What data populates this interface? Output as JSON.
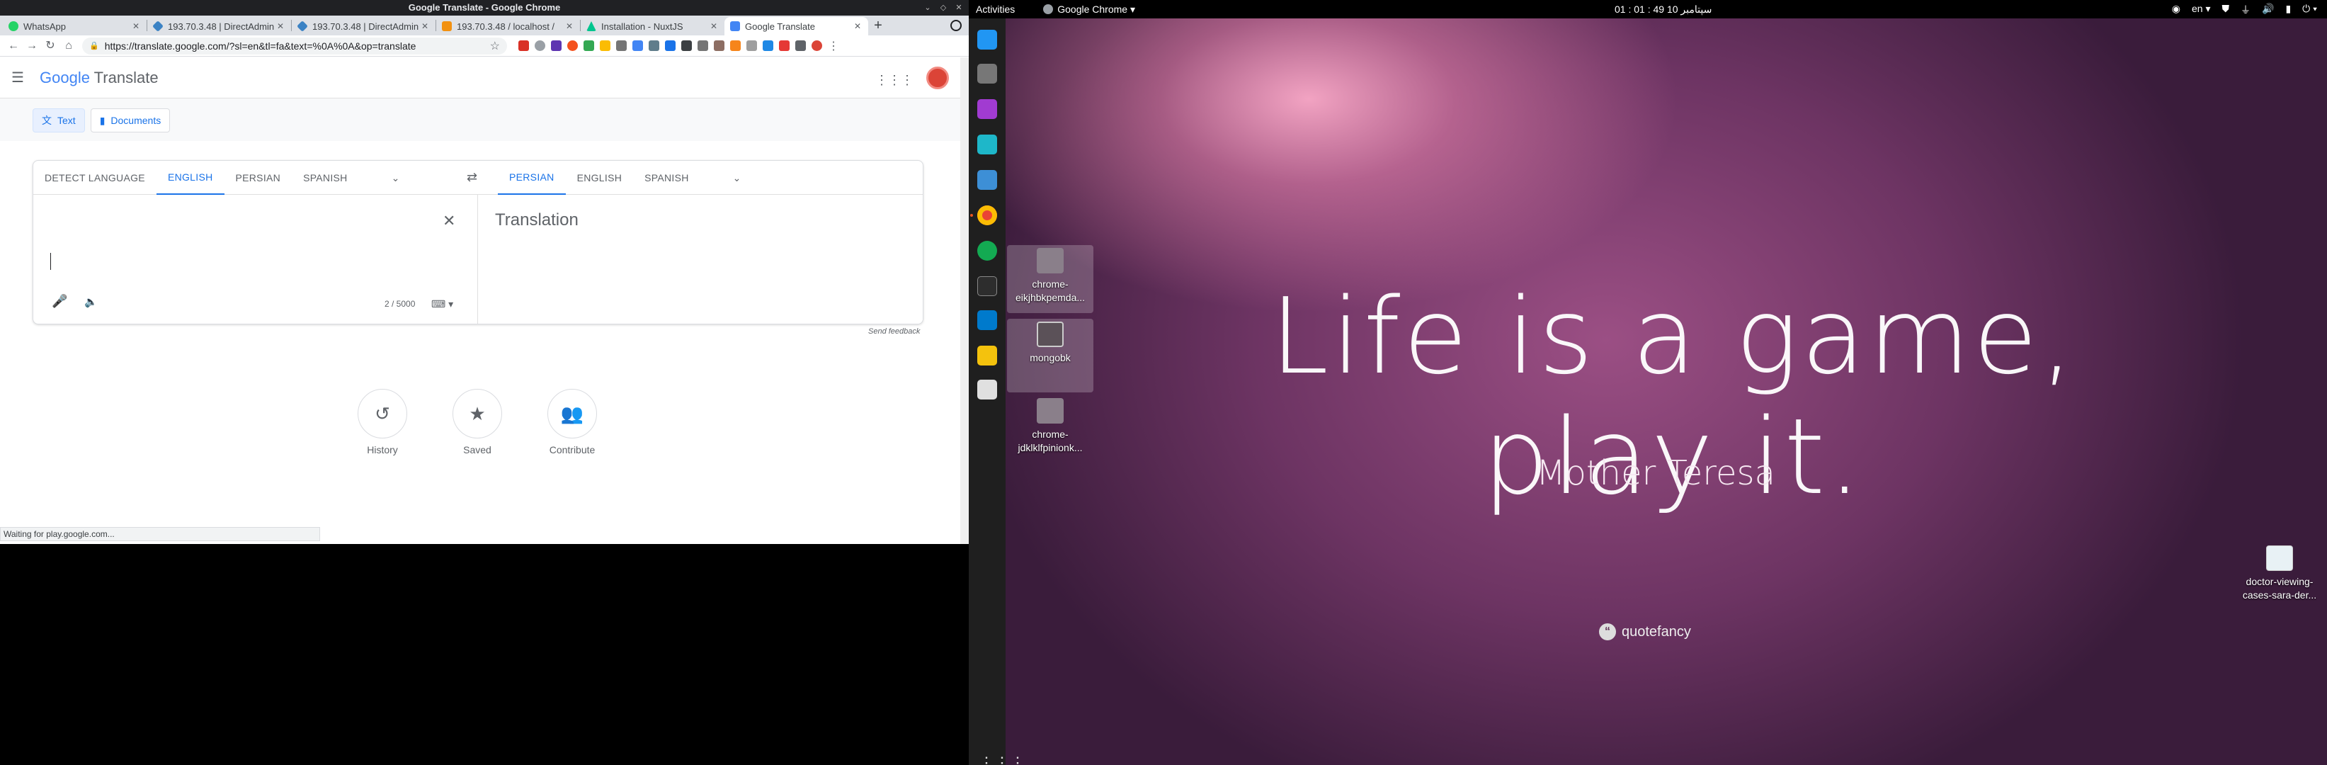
{
  "chrome": {
    "window_title": "Google Translate - Google Chrome",
    "tabs": [
      {
        "label": "WhatsApp",
        "favicon_color": "#25d366"
      },
      {
        "label": "193.70.3.48 | DirectAdmin",
        "favicon_color": "#3b82c4"
      },
      {
        "label": "193.70.3.48 | DirectAdmin",
        "favicon_color": "#3b82c4"
      },
      {
        "label": "193.70.3.48 / localhost /",
        "favicon_color": "#f29111"
      },
      {
        "label": "Installation - NuxtJS",
        "favicon_color": "#00c58e"
      },
      {
        "label": "Google Translate",
        "favicon_color": "#4285f4"
      }
    ],
    "url": "https://translate.google.com/?sl=en&tl=fa&text=%0A%0A&op=translate",
    "status_text": "Waiting for play.google.com..."
  },
  "translate": {
    "logo_google": "Google",
    "logo_translate": "Translate",
    "modes": {
      "text": "Text",
      "documents": "Documents"
    },
    "source_langs": [
      "DETECT LANGUAGE",
      "ENGLISH",
      "PERSIAN",
      "SPANISH"
    ],
    "target_langs": [
      "PERSIAN",
      "ENGLISH",
      "SPANISH"
    ],
    "source_text": "",
    "char_count": "2 / 5000",
    "translation_placeholder": "Translation",
    "send_feedback": "Send feedback",
    "shortcuts": {
      "history": "History",
      "saved": "Saved",
      "contribute": "Contribute"
    }
  },
  "desktop": {
    "activities": "Activities",
    "app_menu": "Google Chrome ▾",
    "clock": "01 : 01 : 49  10 سپتامبر",
    "lang_indicator": "en ▾",
    "icons": [
      {
        "label": "chrome-eikjhbkpemda..."
      },
      {
        "label": "mongobk"
      },
      {
        "label": "chrome-jdklklfpinionk..."
      },
      {
        "label": "doctor-viewing-cases-sara-der..."
      }
    ],
    "quote": "Life is a game, play it.",
    "author": "Mother Teresa",
    "brand": "quotefancy"
  },
  "colors": {
    "accent": "#1a73e8",
    "chrome_title_bg": "#202124",
    "dock_bg": "#1f1f1f"
  }
}
